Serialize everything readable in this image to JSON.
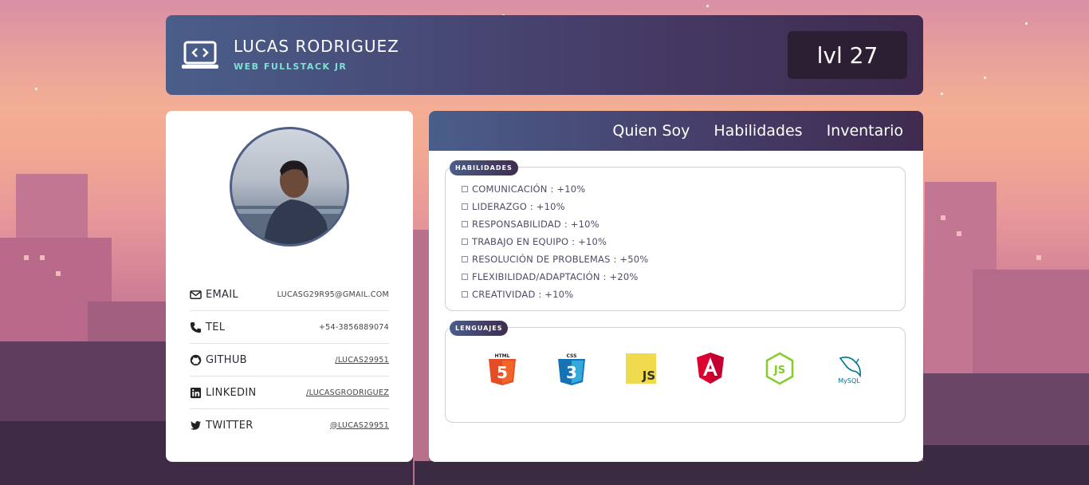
{
  "header": {
    "name": "LUCAS RODRIGUEZ",
    "role": "WEB FULLSTACK JR",
    "level": "lvl 27",
    "logo_icon": "code-laptop-icon"
  },
  "profile": {
    "avatar": "profile-photo",
    "contacts": [
      {
        "icon": "envelope-icon",
        "label": "EMAIL",
        "value": "LUCASG29R95@GMAIL.COM"
      },
      {
        "icon": "phone-icon",
        "label": "TEL",
        "value": "+54-3856889074"
      },
      {
        "icon": "github-icon",
        "label": "GITHUB",
        "value": "/LUCAS29951"
      },
      {
        "icon": "linkedin-icon",
        "label": "LINKEDIN",
        "value": "/LUCASGRODRIGUEZ"
      },
      {
        "icon": "twitter-icon",
        "label": "TWITTER",
        "value": "@LUCAS29951"
      }
    ]
  },
  "tabs": [
    "Quien Soy",
    "Habilidades",
    "Inventario"
  ],
  "skills": {
    "title": "HABILIDADES",
    "items": [
      "COMUNICACIÓN : +10%",
      "LIDERAZGO : +10%",
      "RESPONSABILIDAD : +10%",
      "TRABAJO EN EQUIPO : +10%",
      "RESOLUCIÓN DE PROBLEMAS : +50%",
      "FLEXIBILIDAD/ADAPTACIÓN : +20%",
      "CREATIVIDAD : +10%"
    ]
  },
  "languages": {
    "title": "LENGUAJES",
    "icons": [
      {
        "name": "html5-icon",
        "label": "HTML",
        "color": "#e44d26"
      },
      {
        "name": "css3-icon",
        "label": "CSS",
        "color": "#1572b6"
      },
      {
        "name": "javascript-icon",
        "label": "JS",
        "color": "#f0db4f"
      },
      {
        "name": "angular-icon",
        "label": "",
        "color": "#dd0031"
      },
      {
        "name": "nodejs-icon",
        "label": "JS",
        "color": "#83cd29"
      },
      {
        "name": "mysql-icon",
        "label": "MySQL",
        "color": "#00758f"
      }
    ]
  },
  "colors": {
    "accent_start": "#4a5e8a",
    "accent_end": "#3f2b4f",
    "role_teal": "#7fe0d6",
    "level_bg": "#2c1e33"
  }
}
